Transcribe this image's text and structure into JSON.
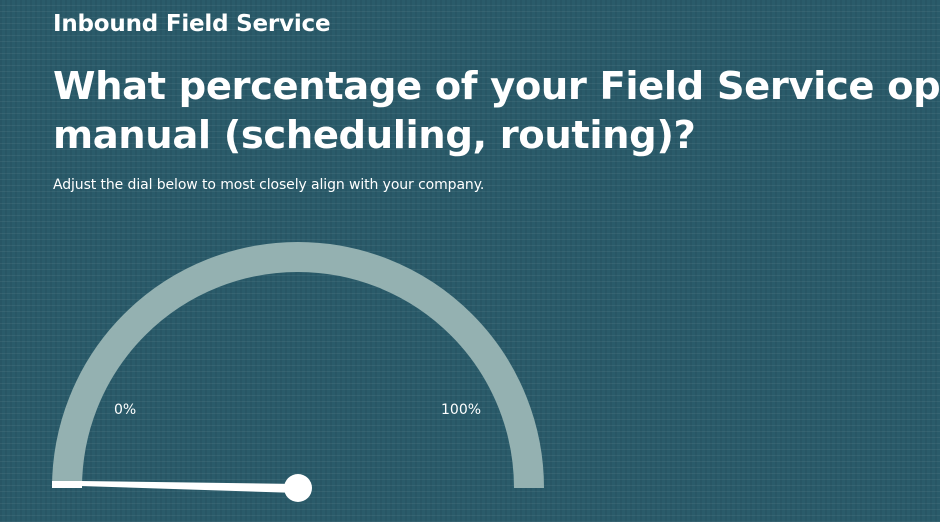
{
  "section_title": "Inbound Field Service",
  "question": {
    "line1": "What percentage of your Field Service operations are",
    "line2": "manual (scheduling, routing)?"
  },
  "instructions": "Adjust the dial below to most closely align with your company.",
  "dial": {
    "min_label": "0%",
    "max_label": "100%",
    "value_percent": 0,
    "track_color": "#94b1b1",
    "needle_color": "#ffffff"
  }
}
